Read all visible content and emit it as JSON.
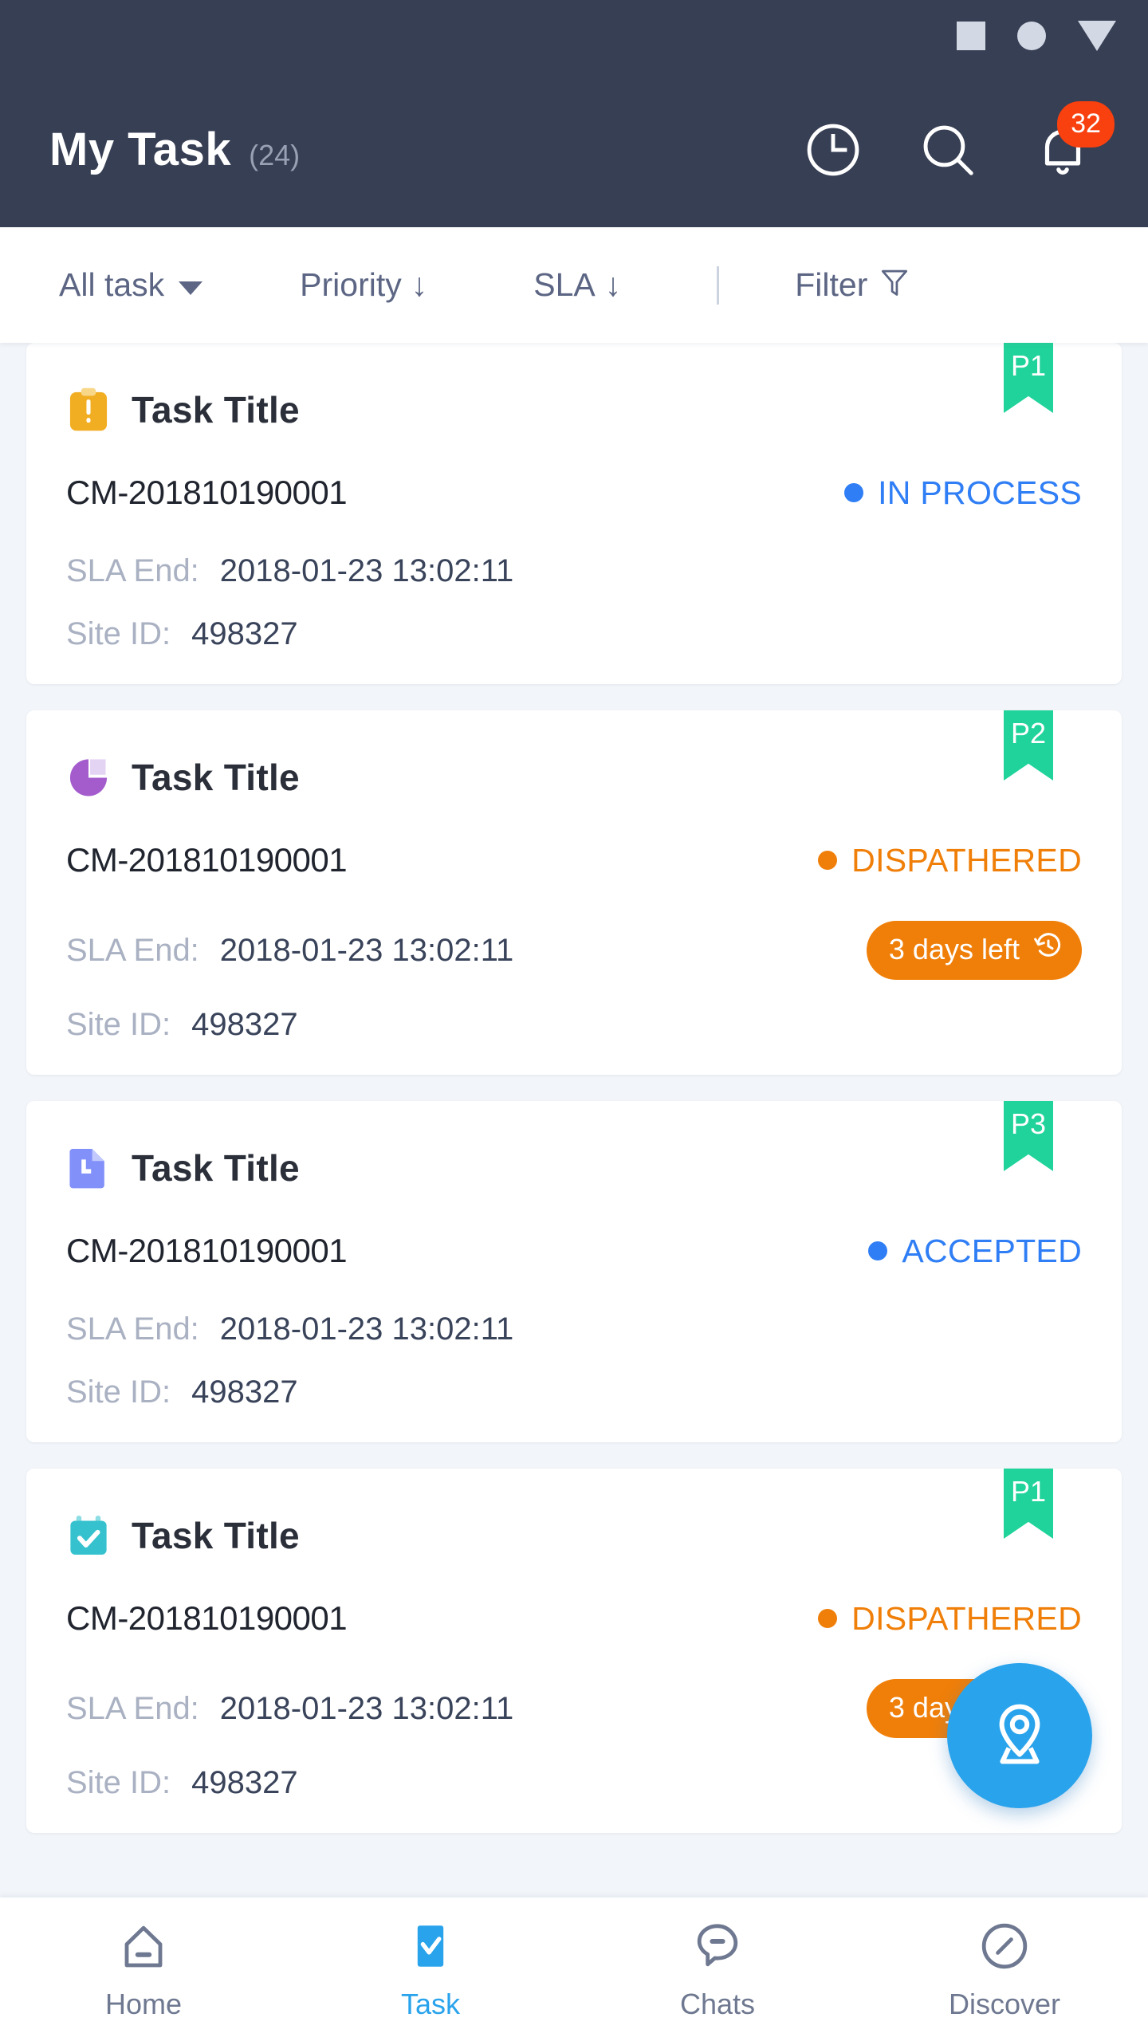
{
  "statusbar": {
    "icons": [
      "square-indicator",
      "circle-indicator",
      "triangle-indicator"
    ]
  },
  "appbar": {
    "title": "My Task",
    "count": "(24)",
    "history_icon": "clock-icon",
    "search_icon": "search-icon",
    "notification_icon": "bell-icon",
    "notification_badge": "32"
  },
  "filterbar": {
    "all_task": "All task",
    "priority": "Priority",
    "sla": "SLA",
    "filter": "Filter",
    "priority_arrow": "↓",
    "sla_arrow": "↓",
    "filter_icon": "funnel-icon",
    "dropdown_icon": "chevron-down-icon"
  },
  "labels": {
    "sla_end": "SLA End:",
    "site_id": "Site ID:"
  },
  "colors": {
    "appbar_bg": "#373f54",
    "accent_blue": "#2f7ef5",
    "orange": "#f07f09",
    "green_ribbon": "#20d39a",
    "badge_red": "#f9400f",
    "fab_blue": "#29a3ec"
  },
  "cards": [
    {
      "priority": "P1",
      "icon": "clipboard-alert-icon",
      "title": "Task Title",
      "code": "CM-201810190001",
      "status": "IN PROCESS",
      "status_color": "#2f7ef5",
      "sla_end": "2018-01-23 13:02:11",
      "site_id": "498327",
      "sla_pill": null
    },
    {
      "priority": "P2",
      "icon": "pie-chart-icon",
      "title": "Task Title",
      "code": "CM-201810190001",
      "status": "DISPATHERED",
      "status_color": "#f07f09",
      "sla_end": "2018-01-23 13:02:11",
      "site_id": "498327",
      "sla_pill": "3 days left"
    },
    {
      "priority": "P3",
      "icon": "document-icon",
      "title": "Task Title",
      "code": "CM-201810190001",
      "status": "ACCEPTED",
      "status_color": "#2f7ef5",
      "sla_end": "2018-01-23 13:02:11",
      "site_id": "498327",
      "sla_pill": null
    },
    {
      "priority": "P1",
      "icon": "calendar-check-icon",
      "title": "Task Title",
      "code": "CM-201810190001",
      "status": "DISPATHERED",
      "status_color": "#f07f09",
      "sla_end": "2018-01-23 13:02:11",
      "site_id": "498327",
      "sla_pill": "3 days left"
    }
  ],
  "fab": {
    "icon": "location-pin-icon"
  },
  "bottomnav": {
    "items": [
      {
        "label": "Home",
        "icon": "home-icon",
        "active": false
      },
      {
        "label": "Task",
        "icon": "task-check-icon",
        "active": true
      },
      {
        "label": "Chats",
        "icon": "chat-icon",
        "active": false
      },
      {
        "label": "Discover",
        "icon": "compass-icon",
        "active": false
      }
    ]
  }
}
